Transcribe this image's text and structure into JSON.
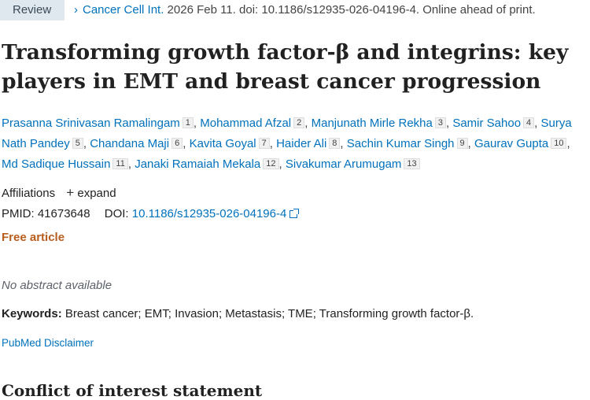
{
  "header": {
    "pub_type": "Review",
    "journal": "Cancer Cell Int.",
    "citation_rest": "2026 Feb 11. doi: 10.1186/s12935-026-04196-4. Online ahead of print."
  },
  "article": {
    "title": "Transforming growth factor-β and integrins: key players in EMT and breast cancer progression",
    "authors": [
      {
        "name": "Prasanna Srinivasan Ramalingam",
        "aff": "1"
      },
      {
        "name": "Mohammad Afzal",
        "aff": "2"
      },
      {
        "name": "Manjunath Mirle Rekha",
        "aff": "3"
      },
      {
        "name": "Samir Sahoo",
        "aff": "4"
      },
      {
        "name": "Surya Nath Pandey",
        "aff": "5"
      },
      {
        "name": "Chandana Maji",
        "aff": "6"
      },
      {
        "name": "Kavita Goyal",
        "aff": "7"
      },
      {
        "name": "Haider Ali",
        "aff": "8"
      },
      {
        "name": "Sachin Kumar Singh",
        "aff": "9"
      },
      {
        "name": "Gaurav Gupta",
        "aff": "10"
      },
      {
        "name": "Md Sadique Hussain",
        "aff": "11"
      },
      {
        "name": "Janaki Ramaiah Mekala",
        "aff": "12"
      },
      {
        "name": "Sivakumar Arumugam",
        "aff": "13"
      }
    ],
    "affiliations_label": "Affiliations",
    "expand_label": "expand",
    "pmid_label": "PMID:",
    "pmid": "41673648",
    "doi_label": "DOI:",
    "doi": "10.1186/s12935-026-04196-4",
    "free_label": "Free article",
    "no_abstract": "No abstract available",
    "keywords_label": "Keywords:",
    "keywords": "Breast cancer; EMT; Invasion; Metastasis; TME; Transforming growth factor-β.",
    "disclaimer": "PubMed Disclaimer",
    "coi_heading": "Conflict of interest statement"
  },
  "colors": {
    "link": "#0071bc",
    "free": "#b95d1d",
    "pubtype_bg": "#dfe8ef"
  }
}
